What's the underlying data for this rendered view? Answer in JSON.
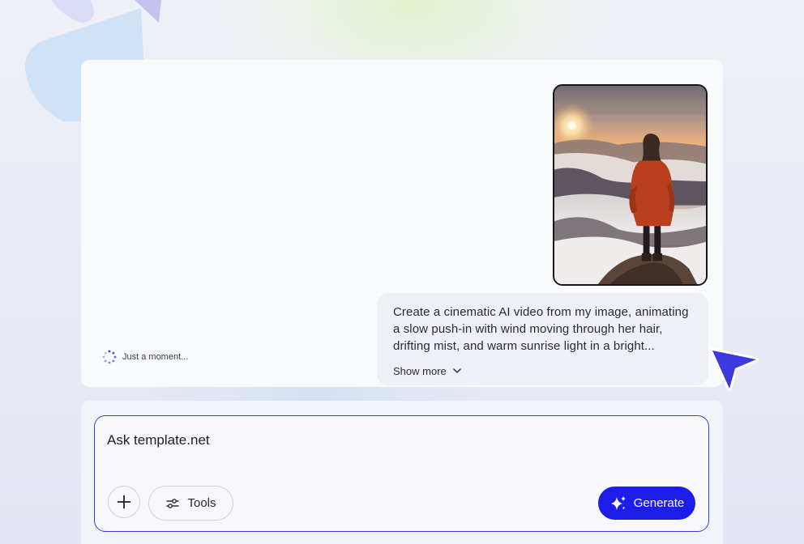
{
  "chat": {
    "loading_text": "Just a moment...",
    "user_image": {
      "icon": "uploaded-image"
    },
    "user_message": {
      "lines": [
        "Create a cinematic AI video from my image, animating",
        "a slow push-in with wind moving through her hair,",
        "drifting mist, and warm sunrise light in a bright..."
      ],
      "show_more_label": "Show more"
    }
  },
  "composer": {
    "placeholder": "Ask template.net",
    "tools_label": "Tools",
    "generate_label": "Generate"
  },
  "colors": {
    "accent": "#1d1ce8",
    "composer_border": "#3b3bd8",
    "cursor": "#3a3ae0",
    "bubble_bg": "#eff0f5",
    "card_bg": "#f9fafc"
  },
  "icons": {
    "add": "plus-icon",
    "tools": "sliders-icon",
    "generate": "sparkles-icon",
    "show_more": "chevron-down-icon",
    "loading": "spinner-icon",
    "cursor": "pointer-cursor-icon"
  }
}
